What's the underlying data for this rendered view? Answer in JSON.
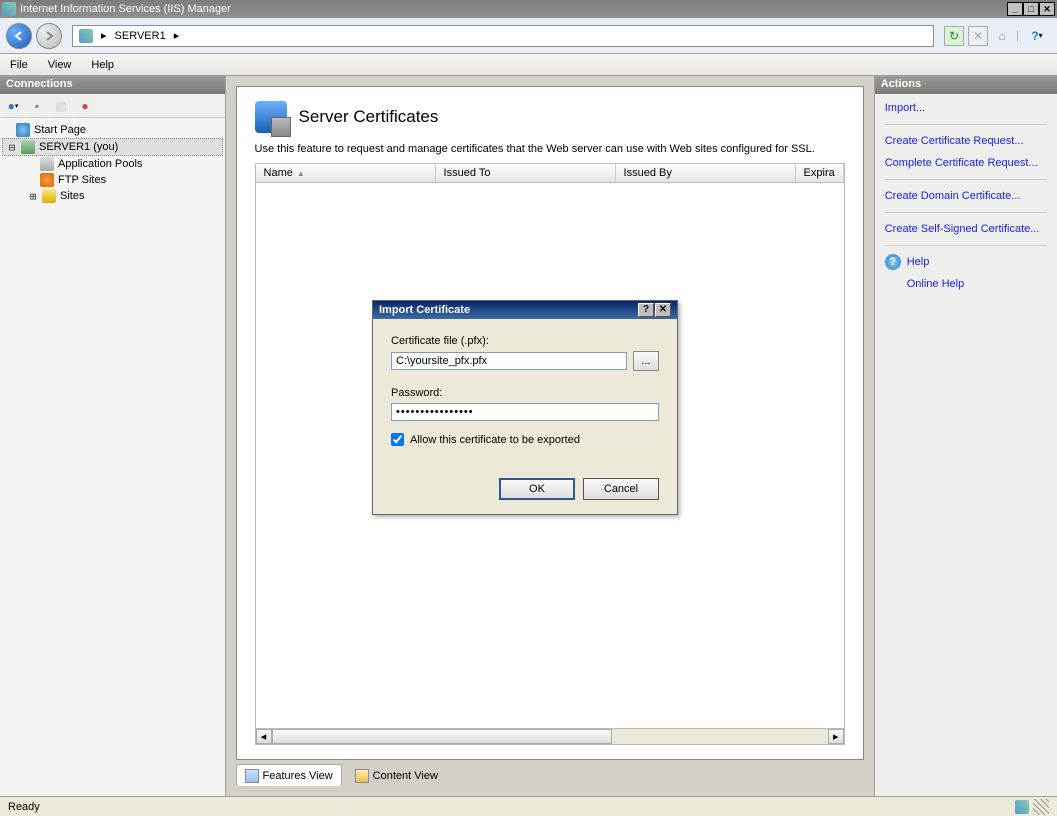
{
  "window": {
    "title": "Internet Information Services (IIS) Manager"
  },
  "breadcrumb": {
    "server": "SERVER1"
  },
  "menubar": {
    "file": "File",
    "view": "View",
    "help": "Help"
  },
  "connections": {
    "header": "Connections",
    "tree": {
      "start_page": "Start Page",
      "server": "SERVER1 (you)",
      "app_pools": "Application Pools",
      "ftp_sites": "FTP Sites",
      "sites": "Sites"
    }
  },
  "main": {
    "title": "Server Certificates",
    "description": "Use this feature to request and manage certificates that the Web server can use with Web sites configured for SSL.",
    "columns": {
      "name": "Name",
      "issued_to": "Issued To",
      "issued_by": "Issued By",
      "expiration": "Expira"
    },
    "tabs": {
      "features": "Features View",
      "content": "Content View"
    }
  },
  "actions": {
    "header": "Actions",
    "import": "Import...",
    "create_request": "Create Certificate Request...",
    "complete_request": "Complete Certificate Request...",
    "create_domain": "Create Domain Certificate...",
    "create_self": "Create Self-Signed Certificate...",
    "help": "Help",
    "online_help": "Online Help"
  },
  "dialog": {
    "title": "Import Certificate",
    "file_label": "Certificate file (.pfx):",
    "file_value": "C:\\yoursite_pfx.pfx",
    "browse": "...",
    "password_label": "Password:",
    "password_value": "••••••••••••••••",
    "allow_export": "Allow this certificate to be exported",
    "allow_export_checked": true,
    "ok": "OK",
    "cancel": "Cancel"
  },
  "statusbar": {
    "ready": "Ready"
  }
}
